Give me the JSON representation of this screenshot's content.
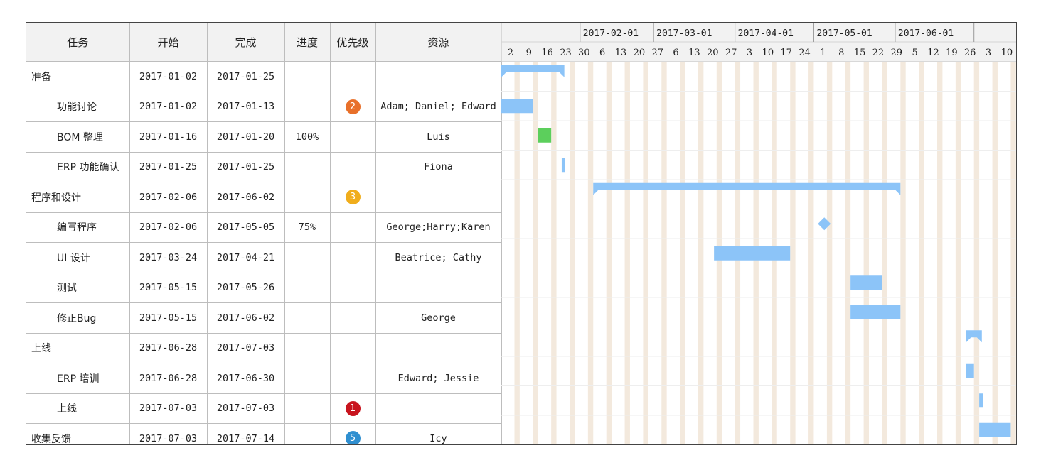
{
  "columns": {
    "task": "任务",
    "start": "开始",
    "finish": "完成",
    "progress": "进度",
    "priority": "优先级",
    "resources": "资源"
  },
  "timeline": {
    "months": [
      "2017-02-01",
      "2017-03-01",
      "2017-04-01",
      "2017-05-01",
      "2017-06-01"
    ],
    "weeks": [
      "2",
      "9",
      "16",
      "23",
      "30",
      "6",
      "13",
      "20",
      "27",
      "6",
      "13",
      "20",
      "27",
      "3",
      "10",
      "17",
      "24",
      "1",
      "8",
      "15",
      "22",
      "29",
      "5",
      "12",
      "19",
      "26",
      "3",
      "10"
    ]
  },
  "tasks": [
    {
      "name": "准备",
      "indent": 0,
      "start": "2017-01-02",
      "finish": "2017-01-25",
      "progress": "",
      "priority": "",
      "priority_color": "",
      "resources": "",
      "kind": "summary"
    },
    {
      "name": "功能讨论",
      "indent": 1,
      "start": "2017-01-02",
      "finish": "2017-01-13",
      "progress": "",
      "priority": "2",
      "priority_color": "#e8702a",
      "resources": "Adam; Daniel; Edward",
      "kind": "task"
    },
    {
      "name": "BOM 整理",
      "indent": 1,
      "start": "2017-01-16",
      "finish": "2017-01-20",
      "progress": "100%",
      "priority": "",
      "priority_color": "",
      "resources": "Luis",
      "kind": "done"
    },
    {
      "name": "ERP 功能确认",
      "indent": 1,
      "start": "2017-01-25",
      "finish": "2017-01-25",
      "progress": "",
      "priority": "",
      "priority_color": "",
      "resources": "Fiona",
      "kind": "task"
    },
    {
      "name": "程序和设计",
      "indent": 0,
      "start": "2017-02-06",
      "finish": "2017-06-02",
      "progress": "",
      "priority": "3",
      "priority_color": "#f0ad1c",
      "resources": "",
      "kind": "summary"
    },
    {
      "name": "编写程序",
      "indent": 1,
      "start": "2017-02-06",
      "finish": "2017-05-05",
      "progress": "75%",
      "priority": "",
      "priority_color": "",
      "resources": "George;Harry;Karen",
      "kind": "milestone"
    },
    {
      "name": "UI 设计",
      "indent": 1,
      "start": "2017-03-24",
      "finish": "2017-04-21",
      "progress": "",
      "priority": "",
      "priority_color": "",
      "resources": "Beatrice; Cathy",
      "kind": "task"
    },
    {
      "name": "测试",
      "indent": 1,
      "start": "2017-05-15",
      "finish": "2017-05-26",
      "progress": "",
      "priority": "",
      "priority_color": "",
      "resources": "",
      "kind": "task"
    },
    {
      "name": "修正Bug",
      "indent": 1,
      "start": "2017-05-15",
      "finish": "2017-06-02",
      "progress": "",
      "priority": "",
      "priority_color": "",
      "resources": "George",
      "kind": "task"
    },
    {
      "name": "上线",
      "indent": 0,
      "start": "2017-06-28",
      "finish": "2017-07-03",
      "progress": "",
      "priority": "",
      "priority_color": "",
      "resources": "",
      "kind": "summary"
    },
    {
      "name": "ERP 培训",
      "indent": 1,
      "start": "2017-06-28",
      "finish": "2017-06-30",
      "progress": "",
      "priority": "",
      "priority_color": "",
      "resources": "Edward; Jessie",
      "kind": "task"
    },
    {
      "name": "上线",
      "indent": 1,
      "start": "2017-07-03",
      "finish": "2017-07-03",
      "progress": "",
      "priority": "1",
      "priority_color": "#c8141e",
      "resources": "",
      "kind": "task"
    },
    {
      "name": "收集反馈",
      "indent": 0,
      "start": "2017-07-03",
      "finish": "2017-07-14",
      "progress": "",
      "priority": "5",
      "priority_color": "#2f8fd0",
      "resources": "Icy",
      "kind": "task"
    }
  ],
  "colors": {
    "bar": "#8cc4f8",
    "done": "#5ccf5c",
    "weekend": "#f3e9dd",
    "row_line": "#eeeeee",
    "header_bg": "#f2f2f2"
  }
}
